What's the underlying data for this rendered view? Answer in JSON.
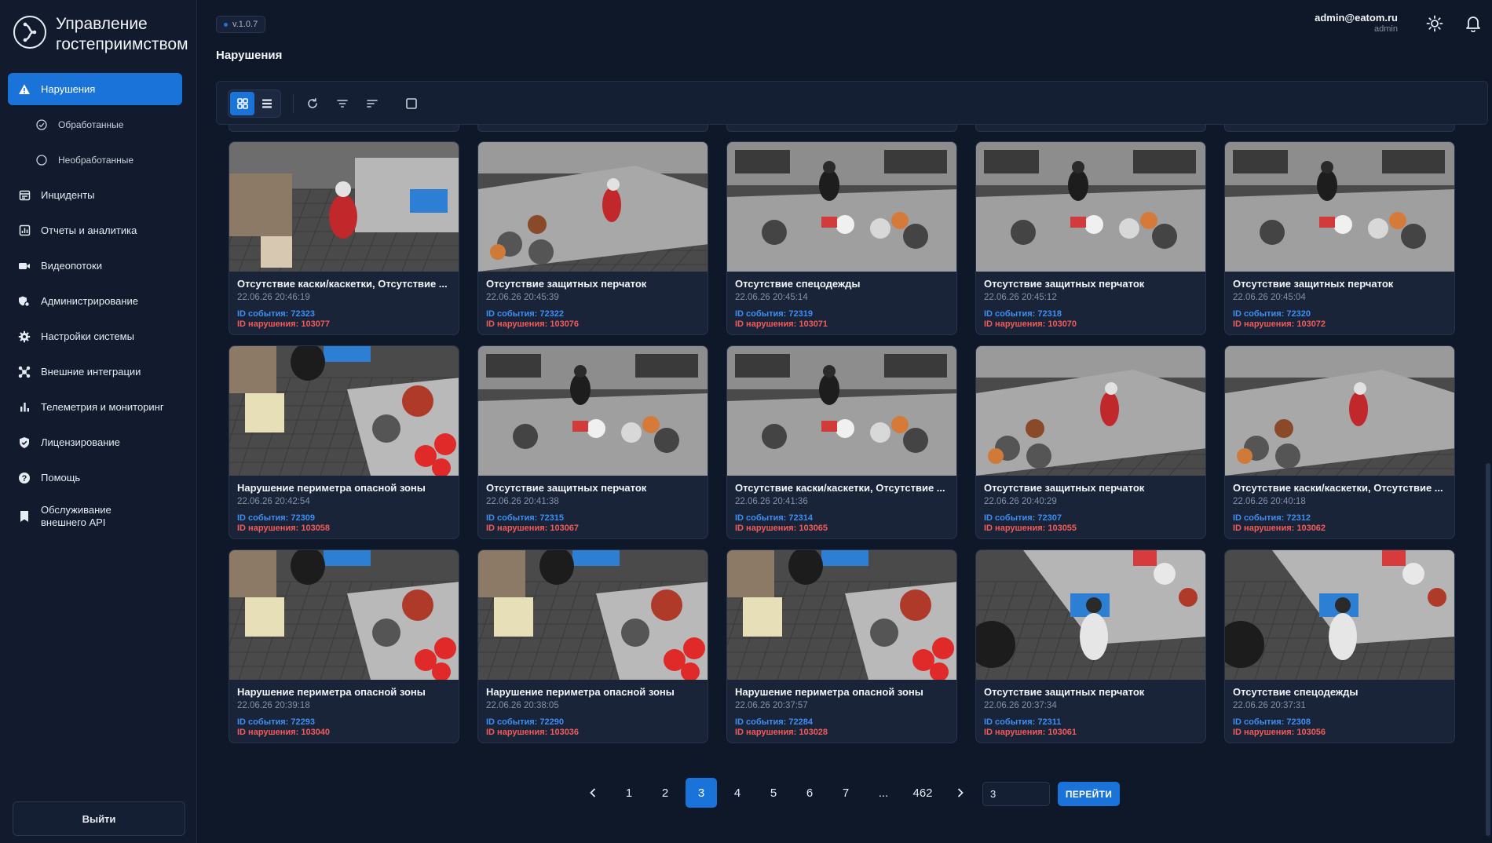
{
  "app": {
    "title": "Управление гостеприимством",
    "version": "v.1.0.7",
    "user_email": "admin@eatom.ru",
    "user_role": "admin"
  },
  "sidebar": {
    "items": [
      {
        "label": "Нарушения",
        "icon": "warning-icon",
        "active": true
      },
      {
        "label": "Обработанные",
        "icon": "check-circle-icon",
        "sub": true
      },
      {
        "label": "Необработанные",
        "icon": "circle-icon",
        "sub": true
      },
      {
        "label": "Инциденты",
        "icon": "calendar-icon"
      },
      {
        "label": "Отчеты и аналитика",
        "icon": "chart-icon"
      },
      {
        "label": "Видеопотоки",
        "icon": "video-icon"
      },
      {
        "label": "Администрирование",
        "icon": "admin-icon"
      },
      {
        "label": "Настройки системы",
        "icon": "gear-icon"
      },
      {
        "label": "Внешние интеграции",
        "icon": "integration-icon"
      },
      {
        "label": "Телеметрия и мониторинг",
        "icon": "bar-chart-icon"
      },
      {
        "label": "Лицензирование",
        "icon": "shield-check-icon"
      },
      {
        "label": "Помощь",
        "icon": "help-icon"
      },
      {
        "label": "Обслуживание внешнего API",
        "icon": "bookmark-icon"
      }
    ],
    "logout_label": "Выйти"
  },
  "page": {
    "title": "Нарушения"
  },
  "cards": [
    {
      "title": "Отсутствие каски/кaскетки, Отсутствие ...",
      "time": "22.06.26 20:46:19",
      "event_label": "ID события: 72323",
      "violation_label": "ID нарушения: 103077",
      "scene": "A"
    },
    {
      "title": "Отсутствие защитных перчаток",
      "time": "22.06.26 20:45:39",
      "event_label": "ID события: 72322",
      "violation_label": "ID нарушения: 103076",
      "scene": "B"
    },
    {
      "title": "Отсутствие спецодежды",
      "time": "22.06.26 20:45:14",
      "event_label": "ID события: 72319",
      "violation_label": "ID нарушения: 103071",
      "scene": "C"
    },
    {
      "title": "Отсутствие защитных перчаток",
      "time": "22.06.26 20:45:12",
      "event_label": "ID события: 72318",
      "violation_label": "ID нарушения: 103070",
      "scene": "C"
    },
    {
      "title": "Отсутствие защитных перчаток",
      "time": "22.06.26 20:45:04",
      "event_label": "ID события: 72320",
      "violation_label": "ID нарушения: 103072",
      "scene": "C"
    },
    {
      "title": "Нарушение периметра опасной зоны",
      "time": "22.06.26 20:42:54",
      "event_label": "ID события: 72309",
      "violation_label": "ID нарушения: 103058",
      "scene": "D"
    },
    {
      "title": "Отсутствие защитных перчаток",
      "time": "22.06.26 20:41:38",
      "event_label": "ID события: 72315",
      "violation_label": "ID нарушения: 103067",
      "scene": "C"
    },
    {
      "title": "Отсутствие каски/каскетки, Отсутствие ...",
      "time": "22.06.26 20:41:36",
      "event_label": "ID события: 72314",
      "violation_label": "ID нарушения: 103065",
      "scene": "C"
    },
    {
      "title": "Отсутствие защитных перчаток",
      "time": "22.06.26 20:40:29",
      "event_label": "ID события: 72307",
      "violation_label": "ID нарушения: 103055",
      "scene": "B"
    },
    {
      "title": "Отсутствие каски/каскетки, Отсутствие ...",
      "time": "22.06.26 20:40:18",
      "event_label": "ID события: 72312",
      "violation_label": "ID нарушения: 103062",
      "scene": "B"
    },
    {
      "title": "Нарушение периметра опасной зоны",
      "time": "22.06.26 20:39:18",
      "event_label": "ID события: 72293",
      "violation_label": "ID нарушения: 103040",
      "scene": "D"
    },
    {
      "title": "Нарушение периметра опасной зоны",
      "time": "22.06.26 20:38:05",
      "event_label": "ID события: 72290",
      "violation_label": "ID нарушения: 103036",
      "scene": "D"
    },
    {
      "title": "Нарушение периметра опасной зоны",
      "time": "22.06.26 20:37:57",
      "event_label": "ID события: 72284",
      "violation_label": "ID нарушения: 103028",
      "scene": "D"
    },
    {
      "title": "Отсутствие защитных перчаток",
      "time": "22.06.26 20:37:34",
      "event_label": "ID события: 72311",
      "violation_label": "ID нарушения: 103061",
      "scene": "E"
    },
    {
      "title": "Отсутствие спецодежды",
      "time": "22.06.26 20:37:31",
      "event_label": "ID события: 72308",
      "violation_label": "ID нарушения: 103056",
      "scene": "E"
    }
  ],
  "pagination": {
    "pages": [
      "1",
      "2",
      "3",
      "4",
      "5",
      "6",
      "7",
      "...",
      "462"
    ],
    "current": "3",
    "input_value": "3",
    "go_label": "ПЕРЕЙТИ"
  },
  "colors": {
    "accent": "#1a73d9",
    "event_id": "#3d8ef5",
    "violation_id": "#f15b5b"
  }
}
